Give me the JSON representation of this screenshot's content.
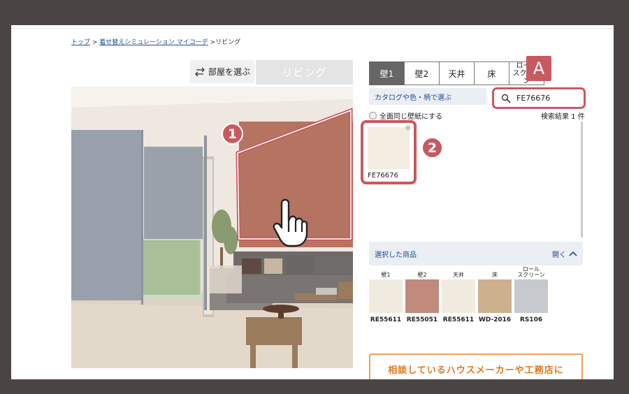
{
  "breadcrumb": {
    "top": "トップ",
    "sep": " > ",
    "simulation": "着せ替えシミュレーション マイコーデ",
    "current": " >リビング"
  },
  "room": {
    "select_label": "部屋を選ぶ",
    "current": "リビング"
  },
  "tabs": [
    "壁1",
    "壁2",
    "天井",
    "床",
    "ロール\nスクリーン"
  ],
  "catalog_label": "カタログや色・柄で選ぶ",
  "search": {
    "value": "FE76676"
  },
  "full_wall_label": "全面同じ壁紙にする",
  "result_count": "検索結果 1 件",
  "result": {
    "code": "FE76676",
    "color": "#f3ede1"
  },
  "annotations": {
    "a": "A",
    "one": "1",
    "two": "2"
  },
  "selected": {
    "title": "選択した商品",
    "toggle": "開く",
    "items": [
      {
        "label": "壁1",
        "code": "RE55611",
        "color": "#f1ebdf"
      },
      {
        "label": "壁2",
        "code": "RE55051",
        "color": "#c08a7c"
      },
      {
        "label": "天井",
        "code": "RE55611",
        "color": "#f1ebdf"
      },
      {
        "label": "床",
        "code": "WD-2016",
        "color": "#cdb08e"
      },
      {
        "label": "ロール\nスクリーン",
        "code": "RS106",
        "color": "#c6c9ce"
      }
    ]
  },
  "consult_label": "相談しているハウスメーカーや工務店に",
  "colors": {
    "accent": "#c8595e",
    "link": "#1a4e9a",
    "wall_highlight": "#b57462"
  }
}
